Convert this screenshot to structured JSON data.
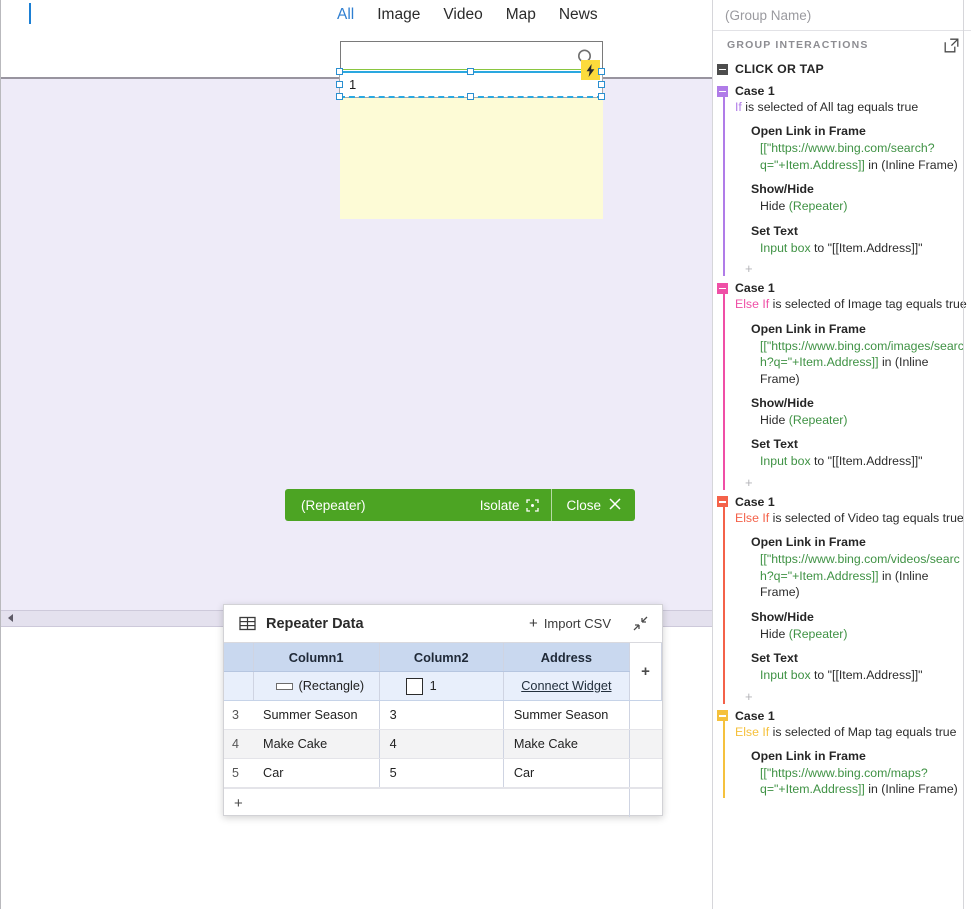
{
  "canvas": {
    "nav_tabs": [
      {
        "label": "All",
        "selected": true
      },
      {
        "label": "Image",
        "selected": false
      },
      {
        "label": "Video",
        "selected": false
      },
      {
        "label": "Map",
        "selected": false
      },
      {
        "label": "News",
        "selected": false
      }
    ],
    "search_icon": "search-icon",
    "lightning_icon": "lightning-bolt-icon",
    "input_box_value": "1",
    "repeater_bar": {
      "name": "(Repeater)",
      "isolate_label": "Isolate",
      "isolate_icon": "isolate-icon",
      "close_label": "Close",
      "close_icon": "close-icon",
      "color": "#4ca423"
    }
  },
  "repeater_data": {
    "title": "Repeater Data",
    "grid_icon": "table-grid-icon",
    "import_label": "Import CSV",
    "import_plus": "+",
    "collapse_icon": "collapse-arrows-icon",
    "columns": [
      "Column1",
      "Column2",
      "Address"
    ],
    "add_column": "+",
    "widget_row": {
      "col1": "(Rectangle)",
      "col1_icon": "rectangle-widget-icon",
      "col2": "1",
      "col2_icon": "checkbox-widget-icon",
      "col3": "Connect Widget"
    },
    "rows": [
      {
        "num": "3",
        "col1": "Summer Season",
        "col2": "3",
        "col3": "Summer Season"
      },
      {
        "num": "4",
        "col1": "Make Cake",
        "col2": "4",
        "col3": "Make Cake"
      },
      {
        "num": "5",
        "col1": "Car",
        "col2": "5",
        "col3": "Car"
      }
    ],
    "add_row": "+"
  },
  "interactions_panel": {
    "group_name_placeholder": "(Group Name)",
    "section_label": "GROUP INTERACTIONS",
    "expand_icon": "open-external-icon",
    "event": {
      "name": "CLICK OR TAP",
      "collapse_icon": "minus-icon"
    },
    "cases": [
      {
        "title": "Case 1",
        "color": "#b07ce8",
        "keyword": "If",
        "condition": " is selected of All tag equals true",
        "actions": [
          {
            "name": "Open Link in Frame",
            "value_green": "[[\"https://www.bing.com/search?q=\"+Item.Address]]",
            "value_plain": " in (Inline Frame)"
          },
          {
            "name": "Show/Hide",
            "value_plain": "Hide ",
            "value_green": "(Repeater)",
            "green_last": true
          },
          {
            "name": "Set Text",
            "value_green": "Input box",
            "value_plain": " to \"[[Item.Address]]\"",
            "green_first": true
          }
        ],
        "add_action": "+"
      },
      {
        "title": "Case 1",
        "color": "#ef4fa6",
        "keyword": "Else If",
        "condition": " is selected of Image tag equals true",
        "actions": [
          {
            "name": "Open Link in Frame",
            "value_green": "[[\"https://www.bing.com/images/search?q=\"+Item.Address]]",
            "value_plain": " in (Inline Frame)"
          },
          {
            "name": "Show/Hide",
            "value_plain": "Hide ",
            "value_green": "(Repeater)",
            "green_last": true
          },
          {
            "name": "Set Text",
            "value_green": "Input box",
            "value_plain": " to \"[[Item.Address]]\"",
            "green_first": true
          }
        ],
        "add_action": "+"
      },
      {
        "title": "Case 1",
        "color": "#f4624a",
        "keyword": "Else If",
        "condition": " is selected of Video tag equals true",
        "actions": [
          {
            "name": "Open Link in Frame",
            "value_green": "[[\"https://www.bing.com/videos/search?q=\"+Item.Address]]",
            "value_plain": " in (Inline Frame)"
          },
          {
            "name": "Show/Hide",
            "value_plain": "Hide ",
            "value_green": "(Repeater)",
            "green_last": true
          },
          {
            "name": "Set Text",
            "value_green": "Input box",
            "value_plain": " to \"[[Item.Address]]\"",
            "green_first": true
          }
        ],
        "add_action": "+"
      },
      {
        "title": "Case 1",
        "color": "#f5c13d",
        "keyword": "Else If",
        "condition": " is selected of Map tag equals true",
        "actions": [
          {
            "name": "Open Link in Frame",
            "value_green": "[[\"https://www.bing.com/maps?q=\"+Item.Address]]",
            "value_plain": " in (Inline Frame)"
          }
        ],
        "add_action": ""
      }
    ]
  }
}
